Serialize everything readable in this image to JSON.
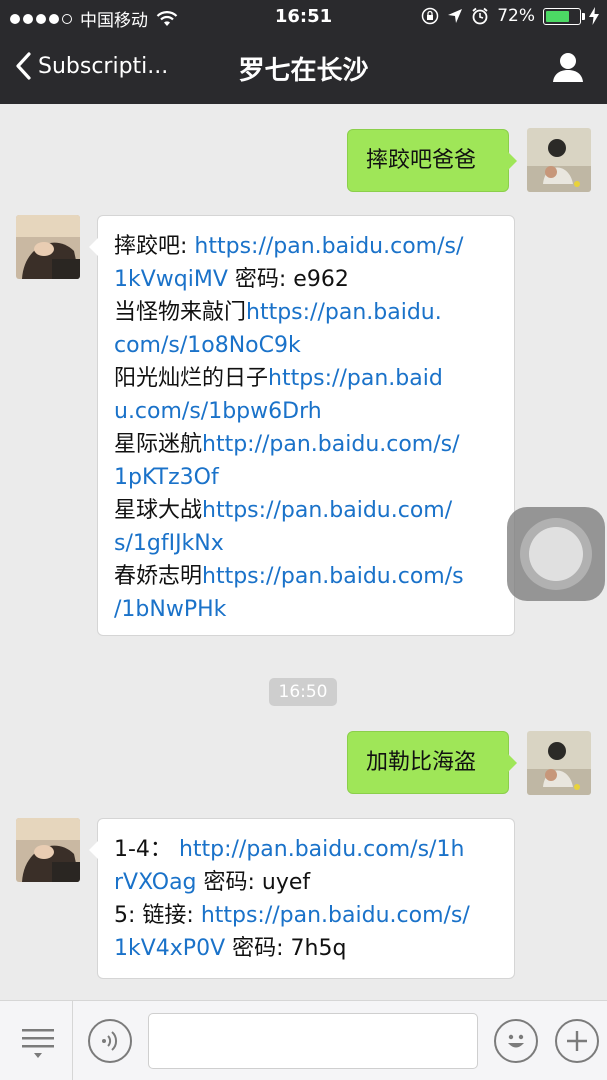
{
  "status": {
    "carrier": "中国移动",
    "time": "16:51",
    "battery": "72%",
    "battery_level": 0.72
  },
  "nav": {
    "back_label": "Subscripti...",
    "title": "罗七在长沙"
  },
  "messages": [
    {
      "from": "me",
      "text": "摔跤吧爸爸"
    },
    {
      "from": "other",
      "lines": [
        {
          "text": "摔跤吧: ",
          "link": "https://pan.baidu.com/s/"
        },
        {
          "link": "1kVwqiMV",
          "text": " 密码: e962"
        },
        {
          "text": "当怪物来敲门",
          "link": "https://pan.baidu."
        },
        {
          "link": "com/s/1o8NoC9k"
        },
        {
          "text": "阳光灿烂的日子",
          "link": "https://pan.baid"
        },
        {
          "link": "u.com/s/1bpw6Drh"
        },
        {
          "text": "星际迷航",
          "link": "http://pan.baidu.com/s/"
        },
        {
          "link": "1pKTz3Of"
        },
        {
          "text": "星球大战",
          "link": "https://pan.baidu.com/"
        },
        {
          "link": "s/1gfIJkNx"
        },
        {
          "text": "春娇志明",
          "link": "https://pan.baidu.com/s"
        },
        {
          "link": "/1bNwPHk"
        }
      ]
    },
    {
      "from": "me",
      "text": "加勒比海盗"
    },
    {
      "from": "other",
      "lines": [
        {
          "text": "1-4：  ",
          "link": "http://pan.baidu.com/s/1h"
        },
        {
          "link": "rVXOag",
          "text": " 密码: uyef"
        },
        {
          "text": "5: 链接: ",
          "link": "https://pan.baidu.com/s/"
        },
        {
          "link": "1kV4xP0V",
          "text": " 密码: 7h5q"
        }
      ]
    }
  ],
  "timestamp": "16:50",
  "colors": {
    "header_bg": "#2a2a2d",
    "chat_bg": "#ebebeb",
    "my_bubble": "#9fe658",
    "link": "#1a72c9"
  },
  "icons": {
    "back": "chevron-left-icon",
    "profile": "person-icon",
    "menu": "menu-list-icon",
    "voice": "voice-icon",
    "emoji": "emoji-icon",
    "plus": "plus-icon"
  },
  "input": {
    "value": ""
  }
}
